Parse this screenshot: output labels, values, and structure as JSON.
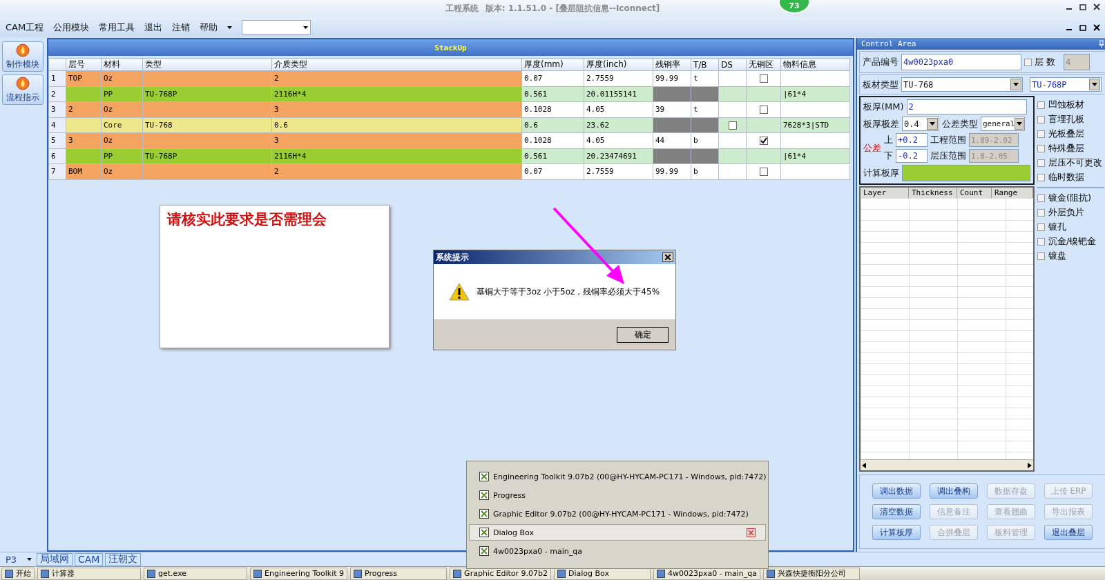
{
  "window": {
    "title": "工程系统",
    "version": "版本: 1.1.51.0 - [叠层阻抗信息--Iconnect]",
    "badge": "73"
  },
  "menu": {
    "items": [
      "CAM工程",
      "公用模块",
      "常用工具",
      "退出",
      "注销",
      "帮助"
    ]
  },
  "sidebar": {
    "items": [
      {
        "label": "制作模块"
      },
      {
        "label": "流程指示"
      }
    ]
  },
  "stackup": {
    "title": "StackUp",
    "columns": [
      "层号",
      "材料",
      "类型",
      "介质类型",
      "厚度(mm)",
      "厚度(inch)",
      "残铜率",
      "T/B",
      "DS",
      "无铜区",
      "物料信息"
    ],
    "rows": [
      {
        "kind": "copper",
        "number": "1",
        "layer": "TOP",
        "material": "Oz",
        "dielectric": "2",
        "thickness_mm": "0.07",
        "thickness_inch": "2.7559",
        "residual_copper": "99.99",
        "tb": "t",
        "no_copper_area": {
          "checked": false
        }
      },
      {
        "kind": "prepreg",
        "number": "2",
        "material": "PP",
        "type": "TU-768P",
        "dielectric": "2116H*4",
        "thickness_mm": "0.561",
        "thickness_inch": "20.01155141",
        "material_info": "|61*4"
      },
      {
        "kind": "copper",
        "number": "3",
        "layer": "2",
        "material": "Oz",
        "dielectric": "3",
        "thickness_mm": "0.1028",
        "thickness_inch": "4.05",
        "residual_copper": "39",
        "tb": "t",
        "no_copper_area": {
          "checked": false
        }
      },
      {
        "kind": "core",
        "number": "4",
        "material": "Core",
        "type": "TU-768",
        "dielectric": "0.6",
        "thickness_mm": "0.6",
        "thickness_inch": "23.62",
        "ds": {
          "checked": false
        },
        "material_info": "7628*3|STD"
      },
      {
        "kind": "copper",
        "number": "5",
        "layer": "3",
        "material": "Oz",
        "dielectric": "3",
        "thickness_mm": "0.1028",
        "thickness_inch": "4.05",
        "residual_copper": "44",
        "tb": "b",
        "no_copper_area": {
          "checked": true
        }
      },
      {
        "kind": "prepreg",
        "number": "6",
        "material": "PP",
        "type": "TU-768P",
        "dielectric": "2116H*4",
        "thickness_mm": "0.561",
        "thickness_inch": "20.23474691",
        "material_info": "|61*4"
      },
      {
        "kind": "copper",
        "number": "7",
        "layer": "BOM",
        "material": "Oz",
        "dielectric": "2",
        "thickness_mm": "0.07",
        "thickness_inch": "2.7559",
        "residual_copper": "99.99",
        "tb": "b",
        "no_copper_area": {
          "checked": false
        }
      }
    ]
  },
  "note": {
    "text": "请核实此要求是否需理会"
  },
  "dialog": {
    "title": "系统提示",
    "message": "基铜大于等于3oz 小于5oz，残铜率必须大于45%",
    "button": "确定"
  },
  "window_list": {
    "items": [
      {
        "label": "Engineering Toolkit 9.07b2 (00@HY-HYCAM-PC171 - Windows, pid:7472)",
        "selected": false
      },
      {
        "label": "Progress",
        "selected": false
      },
      {
        "label": "Graphic Editor 9.07b2 (00@HY-HYCAM-PC171 - Windows, pid:7472)",
        "selected": false
      },
      {
        "label": "Dialog Box",
        "selected": true
      },
      {
        "label": "4w0023pxa0 - main_qa",
        "selected": false
      }
    ]
  },
  "control_area": {
    "title": "Control Area",
    "product": {
      "label": "产品编号",
      "value": "4w0023pxa0",
      "layers_label": "层 数",
      "layers_checked": false,
      "layers": "4"
    },
    "board_material": {
      "label": "板材类型",
      "core": "TU-768",
      "prepreg": "TU-768P"
    },
    "thickness": {
      "label": "板厚(MM)",
      "value": "2"
    },
    "thickness_range": {
      "label": "板厚极差",
      "value": "0.4",
      "type_label": "公差类型",
      "type": "general"
    },
    "tolerance": {
      "label": "公差",
      "upper_label": "上",
      "upper": "+0.2",
      "lower_label": "下",
      "lower": "-0.2",
      "eng_label": "工程范围",
      "eng": "1.89-2.02",
      "press_label": "层压范围",
      "press": "1.8-2.05"
    },
    "calc": {
      "label": "计算板厚"
    },
    "options": [
      {
        "label": "凹蚀板材",
        "checked": false
      },
      {
        "label": "盲埋孔板",
        "checked": false
      },
      {
        "label": "光板叠层",
        "checked": false
      },
      {
        "label": "特殊叠层",
        "checked": false
      },
      {
        "label": "层压不可更改",
        "checked": false
      },
      {
        "label": "临时数据",
        "checked": false
      }
    ],
    "plating": [
      {
        "label": "镀金(阻抗)",
        "checked": false
      },
      {
        "label": "外层负片",
        "checked": false
      },
      {
        "label": "镀孔",
        "checked": false
      },
      {
        "label": "沉金/镍钯金",
        "checked": false
      },
      {
        "label": "镀盘",
        "checked": false
      }
    ],
    "grid_columns": [
      "Layer",
      "Thickness",
      "Count",
      "Range"
    ],
    "buttons": [
      {
        "label": "调出数据",
        "disabled": false
      },
      {
        "label": "调出叠构",
        "disabled": false
      },
      {
        "label": "数据存盘",
        "disabled": true
      },
      {
        "label": "上传 ERP",
        "disabled": true
      },
      {
        "label": "清空数据",
        "disabled": false
      },
      {
        "label": "信息备注",
        "disabled": true
      },
      {
        "label": "查看翘曲",
        "disabled": true
      },
      {
        "label": "导出报表",
        "disabled": true
      },
      {
        "label": "计算板厚",
        "disabled": false
      },
      {
        "label": "合拼叠层",
        "disabled": true
      },
      {
        "label": "板料管理",
        "disabled": true
      },
      {
        "label": "退出叠层",
        "disabled": false
      }
    ]
  },
  "bottom_tabs": {
    "selector": "P3",
    "tabs": [
      "局域网",
      "CAM",
      "汪朝文"
    ]
  },
  "taskbar": {
    "start": "开始",
    "items": [
      "计算器",
      "get.exe",
      "Engineering Toolkit 9",
      "Progress",
      "Graphic Editor 9.07b2",
      "Dialog Box",
      "4w0023pxa0 - main_qa",
      "兴森快捷衡阳分公司"
    ]
  }
}
